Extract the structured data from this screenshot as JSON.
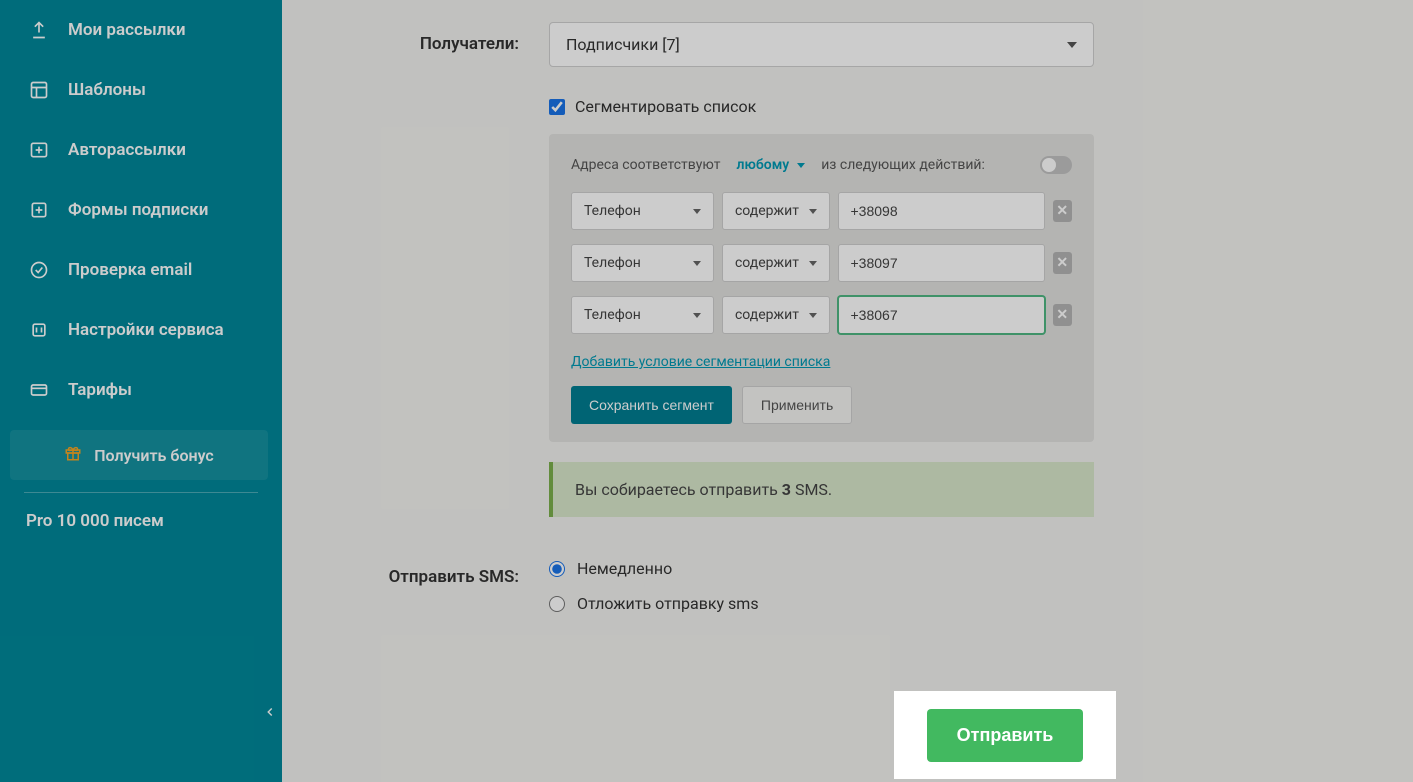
{
  "sidebar": {
    "items": [
      {
        "label": "Мои рассылки"
      },
      {
        "label": "Шаблоны"
      },
      {
        "label": "Авторассылки"
      },
      {
        "label": "Формы подписки"
      },
      {
        "label": "Проверка email"
      },
      {
        "label": "Настройки сервиса"
      },
      {
        "label": "Тарифы"
      }
    ],
    "bonus_label": "Получить бонус",
    "plan_label": "Pro 10 000 писем"
  },
  "recipients": {
    "label": "Получатели:",
    "dropdown_value": "Подписчики [7]",
    "segment_checkbox_label": "Сегментировать список",
    "segment": {
      "prefix": "Адреса соответствуют",
      "match_mode": "любому",
      "suffix": "из следующих действий:",
      "conditions": [
        {
          "field": "Телефон",
          "op": "содержит",
          "value": "+38098"
        },
        {
          "field": "Телефон",
          "op": "содержит",
          "value": "+38097"
        },
        {
          "field": "Телефон",
          "op": "содержит",
          "value": "+38067"
        }
      ],
      "add_cond_label": "Добавить условие сегментации списка",
      "save_segment_label": "Сохранить сегмент",
      "apply_label": "Применить"
    },
    "info_prefix": "Вы собираетесь отправить ",
    "info_count": "3",
    "info_suffix": " SMS."
  },
  "send": {
    "label": "Отправить SMS:",
    "radio_now": "Немедленно",
    "radio_delay": "Отложить отправку sms",
    "submit": "Отправить"
  }
}
